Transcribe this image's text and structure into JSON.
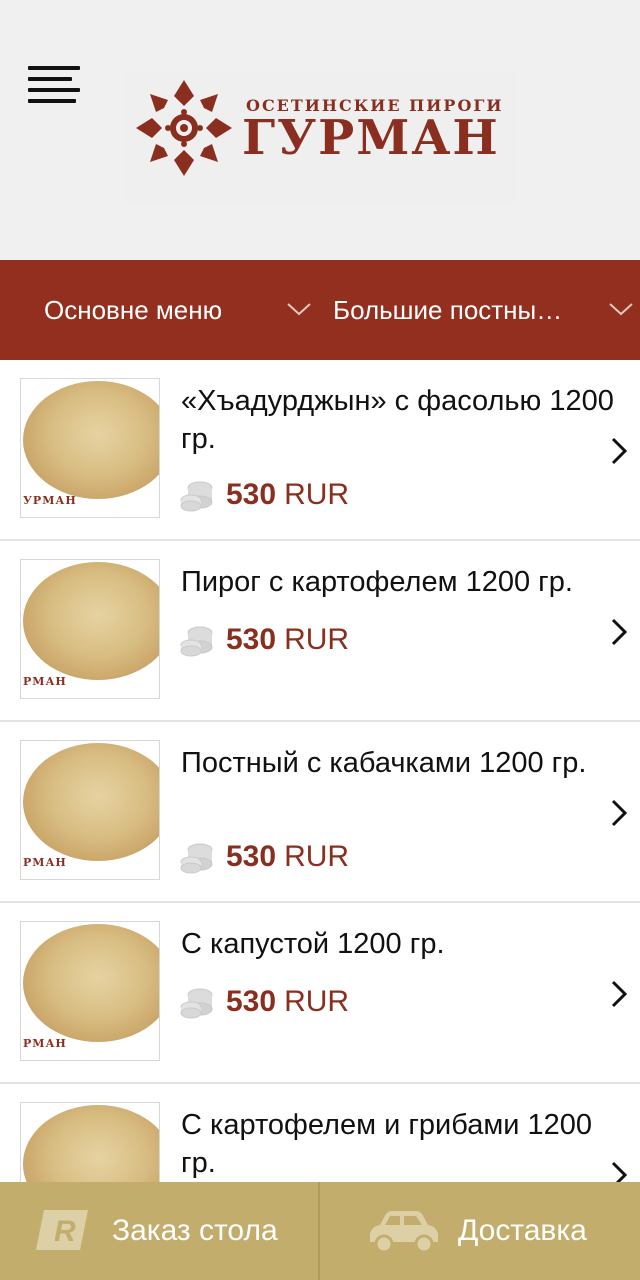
{
  "header": {
    "menu_icon": "hamburger-menu-icon",
    "logo": {
      "subtitle": "ОСЕТИНСКИЕ ПИРОГИ",
      "title": "ГУРМАН",
      "emblem_icon": "ornament-emblem-icon",
      "color": "#8a2f1f"
    }
  },
  "categories": [
    {
      "label": "Основне меню",
      "icon": "chevron-down-icon"
    },
    {
      "label": "Большие постны…",
      "icon": "chevron-down-icon"
    }
  ],
  "items": [
    {
      "title": "«Хъадурджын» с фасолью 1200 гр.",
      "price": "530",
      "currency": "RUR",
      "thumb_brand": "УРМАН"
    },
    {
      "title": "Пирог с картофелем 1200 гр.",
      "price": "530",
      "currency": "RUR",
      "thumb_brand": "РМАН"
    },
    {
      "title": "Постный с кабачками 1200 гр.",
      "price": "530",
      "currency": "RUR",
      "thumb_brand": "РМАН"
    },
    {
      "title": "С капустой 1200 гр.",
      "price": "530",
      "currency": "RUR",
      "thumb_brand": "РМАН"
    },
    {
      "title": "С картофелем и грибами 1200 гр.",
      "price": "",
      "currency": "",
      "thumb_brand": ""
    }
  ],
  "bottom_bar": {
    "reserve_label": "Заказ стола",
    "reserve_icon": "reservation-r-icon",
    "delivery_label": "Доставка",
    "delivery_icon": "car-icon"
  },
  "colors": {
    "accent": "#922f1e",
    "price": "#8a2f1f",
    "bottom_bar": "#c3ad6d",
    "header_bg": "#f0f0f0"
  }
}
